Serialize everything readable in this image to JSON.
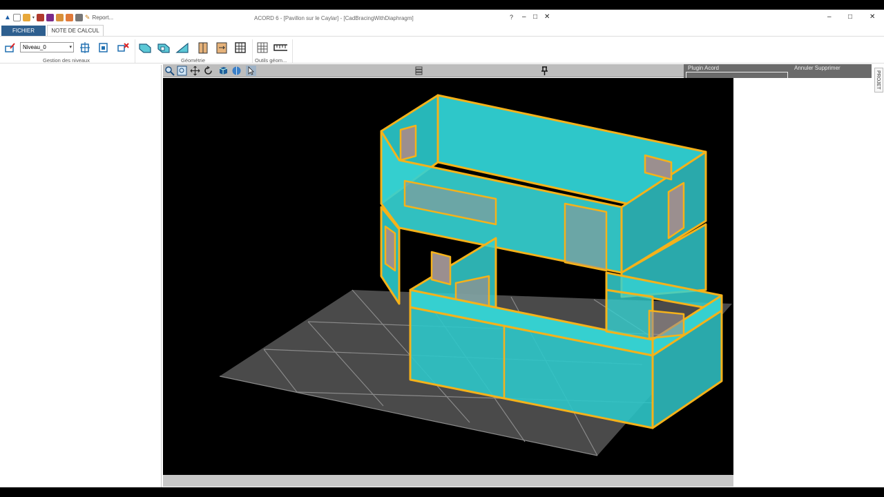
{
  "window": {
    "title": "ACORD 6 - [Pavillon sur le Caylar] - [CadBracingWithDiaphragm]",
    "report_label": "Report...",
    "help": "?",
    "minimize": "–",
    "maximize": "□",
    "close": "✕"
  },
  "tabs": {
    "fichier": "FICHIER",
    "note_de_calcul": "NOTE DE CALCUL"
  },
  "ribbon": {
    "level_value": "Niveau_0",
    "groups": {
      "gestion_niveaux": "Gestion des niveaux",
      "geometrie": "Géométrie",
      "outils_geom": "Outils géom..."
    }
  },
  "side_panels": {
    "plugin_label": "Plugin Acord",
    "annuler_supprimer": "Annuler Supprimer",
    "projet_tab": "PROJET"
  },
  "colors": {
    "wall_fill": "#2ec7c9",
    "wall_edge": "#f5b21a",
    "opening_fill": "#9b8f8f",
    "ground": "#4a4a4a",
    "ribbon_tab_active": "#2e5f8f"
  }
}
